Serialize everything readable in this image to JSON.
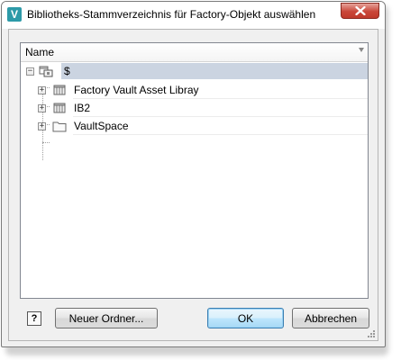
{
  "window": {
    "title": "Bibliotheks-Stammverzeichnis für Factory-Objekt auswählen",
    "app_icon_letter": "V",
    "app_icon_color": "#2d9aa8"
  },
  "tree": {
    "column_header": "Name",
    "root": {
      "label": "$",
      "expanded": true,
      "selected": true
    },
    "children": [
      {
        "label": "Factory Vault Asset Libray",
        "icon": "library-icon",
        "expander": "+"
      },
      {
        "label": "IB2",
        "icon": "library-icon",
        "expander": "+"
      },
      {
        "label": "VaultSpace",
        "icon": "folder-icon",
        "expander": "+"
      }
    ],
    "root_expander": "−"
  },
  "buttons": {
    "help_label": "?",
    "new_folder_label": "Neuer Ordner...",
    "ok_label": "OK",
    "cancel_label": "Abbrechen"
  },
  "colors": {
    "selection": "#cbd4e1",
    "close_button": "#c9473a",
    "default_button_border": "#3c7fb1"
  }
}
